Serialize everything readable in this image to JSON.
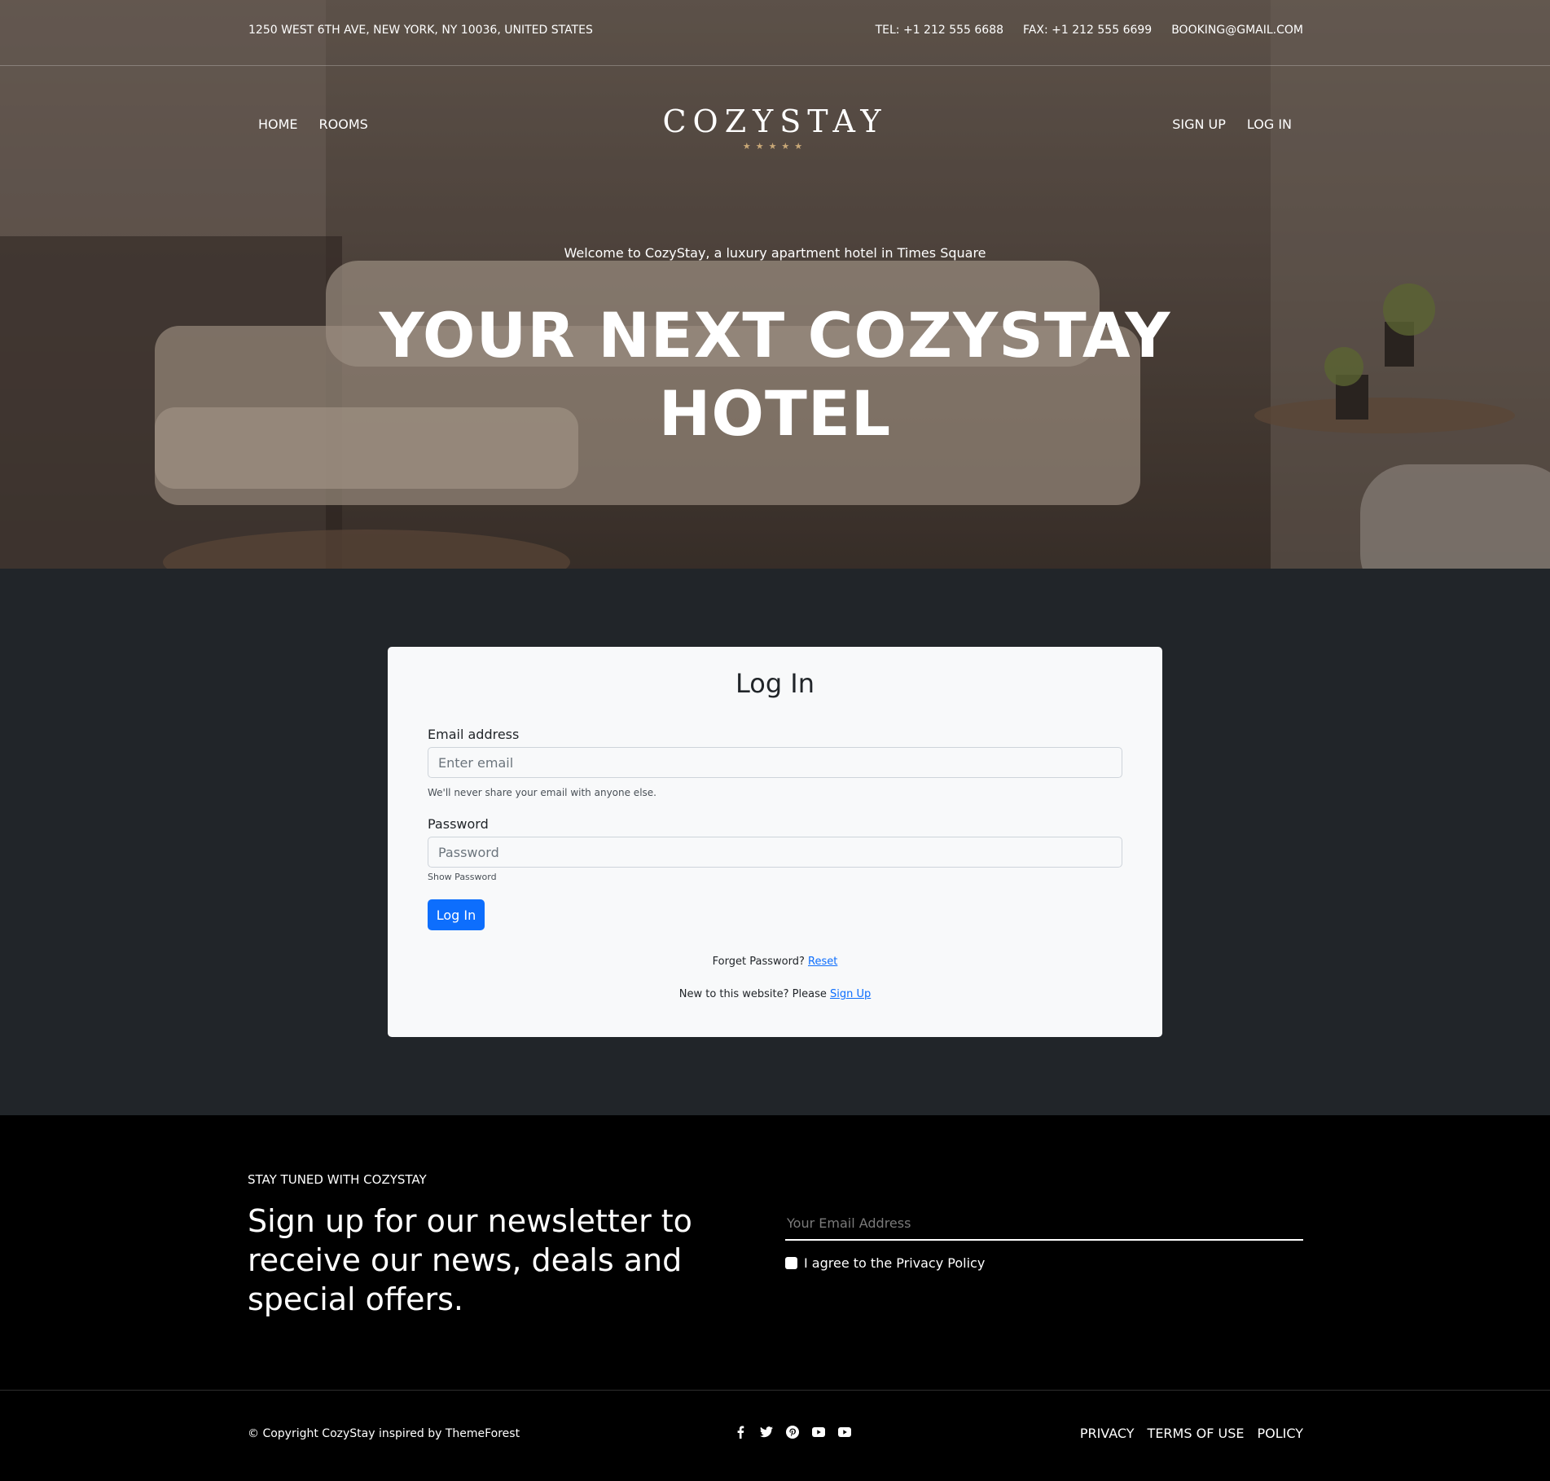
{
  "topbar": {
    "address": "1250 WEST 6TH AVE, NEW YORK, NY 10036, UNITED STATES",
    "tel": "TEL: +1 212 555 6688",
    "fax": "FAX: +1 212 555 6699",
    "email": "BOOKING@GMAIL.COM"
  },
  "nav": {
    "left": [
      "HOME",
      "ROOMS"
    ],
    "right": [
      "SIGN UP",
      "LOG IN"
    ],
    "logo": "COZYSTAY",
    "stars": "★★★★★"
  },
  "hero": {
    "subtitle": "Welcome to CozyStay, a luxury apartment hotel in Times Square",
    "title_line1": "YOUR NEXT COZYSTAY",
    "title_line2": "HOTEL"
  },
  "login": {
    "title": "Log In",
    "email_label": "Email address",
    "email_placeholder": "Enter email",
    "email_help": "We'll never share your email with anyone else.",
    "password_label": "Password",
    "password_placeholder": "Password",
    "show_password": "Show Password",
    "submit_label": "Log In",
    "forgot_text": "Forget Password?",
    "reset_link": "Reset",
    "new_text": "New to this website? Please",
    "signup_link": "Sign Up"
  },
  "newsletter": {
    "kicker": "STAY TUNED WITH COZYSTAY",
    "headline": "Sign up for our newsletter to receive our news, deals and special offers.",
    "email_placeholder": "Your Email Address",
    "agree_label": "I agree to the Privacy Policy"
  },
  "footer": {
    "copyright": "© Copyright CozyStay inspired by ThemeForest",
    "social_icons": [
      "facebook-icon",
      "twitter-icon",
      "pinterest-icon",
      "youtube-icon",
      "youtube-icon"
    ],
    "links": [
      "PRIVACY",
      "TERMS OF USE",
      "POLICY"
    ]
  },
  "colors": {
    "accent": "#0d6efd",
    "star": "#c9a877",
    "page_bg": "#212529",
    "card_bg": "#f8f9fa",
    "footer_bg": "#000000"
  }
}
